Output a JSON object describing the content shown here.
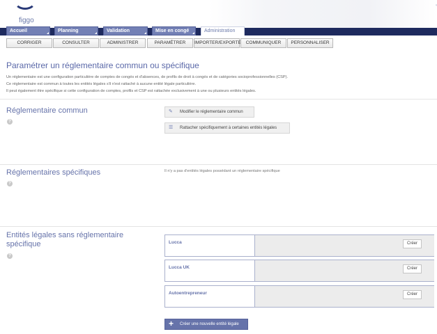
{
  "header": {
    "logo_text": "figgo",
    "deco_text": "figgo"
  },
  "main_nav": [
    {
      "label": "Accueil"
    },
    {
      "label": "Planning"
    },
    {
      "label": "Validation"
    },
    {
      "label": "Mise en congé"
    },
    {
      "label": "Administration",
      "active": true
    }
  ],
  "sub_nav": [
    {
      "label": "CORRIGER"
    },
    {
      "label": "CONSULTER"
    },
    {
      "label": "ADMINISTRER"
    },
    {
      "label": "PARAMÉTRER"
    },
    {
      "label": "IMPORTER/EXPORTER"
    },
    {
      "label": "COMMUNIQUER"
    },
    {
      "label": "PERSONNALISER"
    }
  ],
  "page": {
    "title": "Paramétrer un réglementaire commun ou spécifique",
    "description": [
      "Un réglementaire est une configuration particulière de comptes de congés et d'absences, de profils de droit à congés et de catégories socioprofessionnelles (CSP).",
      "Ce réglementaire est commun à toutes les entités légales s'il n'est rattaché à aucune entité légale particulière.",
      "Il peut également être spécifique si cette configuration de comptes, profils et CSP est rattachée exclusivement à une ou plusieurs entités légales."
    ]
  },
  "common": {
    "title": "Réglementaire commun",
    "modify_label": "Modifier le réglementaire commun",
    "attach_label": "Rattacher spécifiquement à certaines entités légales"
  },
  "specific": {
    "title": "Réglementaires spécifiques",
    "info": "Il n'y a pas d'entités légales possédant un réglementaire spécifique"
  },
  "entities": {
    "title_line1": "Entités légales sans réglementaire",
    "title_line2": "spécifique",
    "items": [
      {
        "name": "Lucca",
        "create_label": "Créer"
      },
      {
        "name": "Lucca UK",
        "create_label": "Créer"
      },
      {
        "name": "Autoentrepreneur",
        "create_label": "Créer"
      }
    ],
    "new_label": "Créer une nouvelle entité légale"
  },
  "help_symbol": "?",
  "colors": {
    "nav_bg": "#1e2a5e",
    "tab_bg": "#7380b5",
    "title": "#5a68a8",
    "button_primary": "#6673aa"
  }
}
